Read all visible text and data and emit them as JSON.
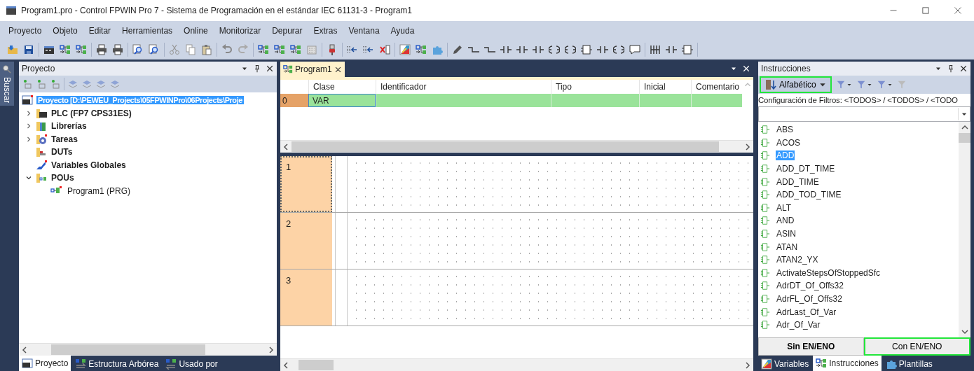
{
  "window": {
    "title": "Program1.pro - Control FPWIN Pro 7 - Sistema de Programación en el estándar IEC 61131-3 - Program1"
  },
  "menu": [
    "Proyecto",
    "Objeto",
    "Editar",
    "Herramientas",
    "Online",
    "Monitorizar",
    "Depurar",
    "Extras",
    "Ventana",
    "Ayuda"
  ],
  "side_tab": {
    "label": "Buscar"
  },
  "project_panel": {
    "title": "Proyecto",
    "tree": [
      {
        "label": "Proyecto [D:\\PEWEU_Projects\\05FPWINPro\\06Projects\\Proje",
        "kind": "project",
        "selected": true,
        "children": [
          {
            "label": "PLC (FP7 CPS31ES)",
            "kind": "plc",
            "selected": false,
            "expanded": false
          },
          {
            "label": "Librerías",
            "kind": "library",
            "selected": false,
            "expanded": false
          },
          {
            "label": "Tareas",
            "kind": "tasks",
            "selected": false,
            "expanded": false
          },
          {
            "label": "DUTs",
            "kind": "duts",
            "selected": false
          },
          {
            "label": "Variables Globales",
            "kind": "globals",
            "selected": false
          },
          {
            "label": "POUs",
            "kind": "pous",
            "selected": false,
            "expanded": true,
            "children": [
              {
                "label": "Program1 (PRG)",
                "kind": "program",
                "selected": false
              }
            ]
          }
        ]
      }
    ],
    "tabs": [
      {
        "label": "Proyecto",
        "selected": true
      },
      {
        "label": "Estructura Arbórea",
        "selected": false
      },
      {
        "label": "Usado por",
        "selected": false
      }
    ]
  },
  "editor": {
    "tab": {
      "label": "Program1",
      "selected": true
    },
    "columns": [
      "Clase",
      "Identificador",
      "Tipo",
      "Inicial",
      "Comentario"
    ],
    "rows": [
      {
        "number": "0",
        "class": "VAR"
      }
    ],
    "rungs": [
      {
        "number": "1",
        "selected": true
      },
      {
        "number": "2",
        "selected": false
      },
      {
        "number": "3",
        "selected": false
      }
    ]
  },
  "instructions_panel": {
    "title": "Instrucciones",
    "sort_button": {
      "label": "Alfabético",
      "highlighted": true
    },
    "filter_text": "Configuración de Filtros: <TODOS> / <TODOS> / <TODO",
    "items": [
      {
        "label": "ABS",
        "selected": false
      },
      {
        "label": "ACOS",
        "selected": false
      },
      {
        "label": "ADD",
        "selected": true
      },
      {
        "label": "ADD_DT_TIME",
        "selected": false
      },
      {
        "label": "ADD_TIME",
        "selected": false
      },
      {
        "label": "ADD_TOD_TIME",
        "selected": false
      },
      {
        "label": "ALT",
        "selected": false
      },
      {
        "label": "AND",
        "selected": false
      },
      {
        "label": "ASIN",
        "selected": false
      },
      {
        "label": "ATAN",
        "selected": false
      },
      {
        "label": "ATAN2_YX",
        "selected": false
      },
      {
        "label": "ActivateStepsOfStoppedSfc",
        "selected": false
      },
      {
        "label": "AdrDT_Of_Offs32",
        "selected": false
      },
      {
        "label": "AdrFL_Of_Offs32",
        "selected": false
      },
      {
        "label": "AdrLast_Of_Var",
        "selected": false
      },
      {
        "label": "Adr_Of_Var",
        "selected": false
      }
    ],
    "mode_buttons": [
      {
        "label": "Sin EN/ENO",
        "selected": true,
        "highlighted": false
      },
      {
        "label": "Con EN/ENO",
        "selected": false,
        "highlighted": true
      }
    ],
    "tabs": [
      {
        "label": "Variables",
        "selected": false
      },
      {
        "label": "Instrucciones",
        "selected": true
      },
      {
        "label": "Plantillas",
        "selected": false
      }
    ]
  }
}
